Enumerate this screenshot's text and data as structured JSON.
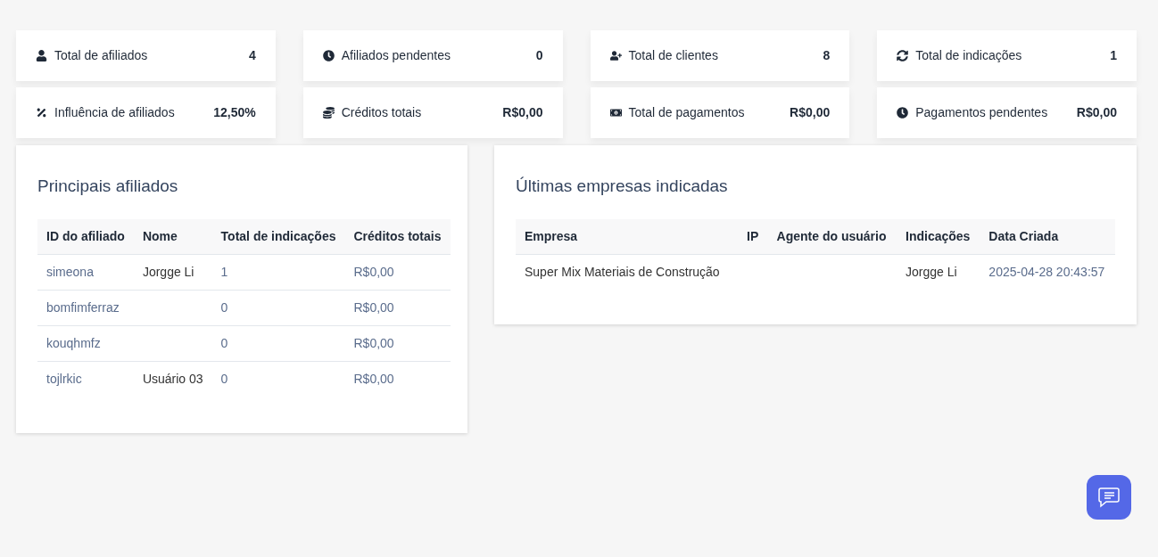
{
  "stats": [
    {
      "label": "Total de afiliados",
      "value": "4"
    },
    {
      "label": "Afiliados pendentes",
      "value": "0"
    },
    {
      "label": "Total de clientes",
      "value": "8"
    },
    {
      "label": "Total de indicações",
      "value": "1"
    },
    {
      "label": "Influência de afiliados",
      "value": "12,50%"
    },
    {
      "label": "Créditos totais",
      "value": "R$0,00"
    },
    {
      "label": "Total de pagamentos",
      "value": "R$0,00"
    },
    {
      "label": "Pagamentos pendentes",
      "value": "R$0,00"
    }
  ],
  "top_affiliates": {
    "title": "Principais afiliados",
    "columns": [
      "ID do afiliado",
      "Nome",
      "Total de indicações",
      "Créditos totais"
    ],
    "rows": [
      [
        {
          "text": "simeona",
          "link": true
        },
        {
          "text": "Jorgge Li",
          "link": false
        },
        {
          "text": "1",
          "link": true
        },
        {
          "text": "R$0,00",
          "link": true
        }
      ],
      [
        {
          "text": "bomfimferraz",
          "link": true
        },
        null,
        {
          "text": "0",
          "link": true
        },
        {
          "text": "R$0,00",
          "link": true
        }
      ],
      [
        {
          "text": "kouqhmfz",
          "link": true
        },
        null,
        {
          "text": "0",
          "link": true
        },
        {
          "text": "R$0,00",
          "link": true
        }
      ],
      [
        {
          "text": "tojlrkic",
          "link": true
        },
        {
          "text": "Usuário 03",
          "link": false
        },
        {
          "text": "0",
          "link": true
        },
        {
          "text": "R$0,00",
          "link": true
        }
      ]
    ]
  },
  "latest_companies": {
    "title": "Últimas empresas indicadas",
    "columns": [
      "Empresa",
      "IP",
      "Agente do usuário",
      "Indicações",
      "Data Criada"
    ],
    "rows": [
      [
        {
          "text": "Super Mix Materiais de Construção",
          "link": false
        },
        null,
        null,
        {
          "text": "Jorgge Li",
          "link": false
        },
        {
          "text": "2025-04-28 20:43:57",
          "link": true
        }
      ]
    ]
  }
}
